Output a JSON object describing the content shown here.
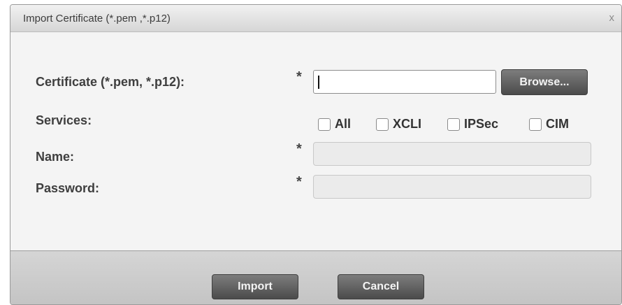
{
  "dialog": {
    "title": "Import Certificate (*.pem ,*.p12)",
    "close_glyph": "x"
  },
  "form": {
    "required_marker": "*",
    "certificate": {
      "label": "Certificate (*.pem, *.p12):",
      "value": "",
      "browse_label": "Browse..."
    },
    "services": {
      "label": "Services:",
      "options": [
        {
          "label": "All",
          "checked": false
        },
        {
          "label": "XCLI",
          "checked": false
        },
        {
          "label": "IPSec",
          "checked": false
        },
        {
          "label": "CIM",
          "checked": false
        }
      ]
    },
    "name": {
      "label": "Name:",
      "value": ""
    },
    "password": {
      "label": "Password:",
      "value": ""
    }
  },
  "footer": {
    "import_label": "Import",
    "cancel_label": "Cancel"
  }
}
